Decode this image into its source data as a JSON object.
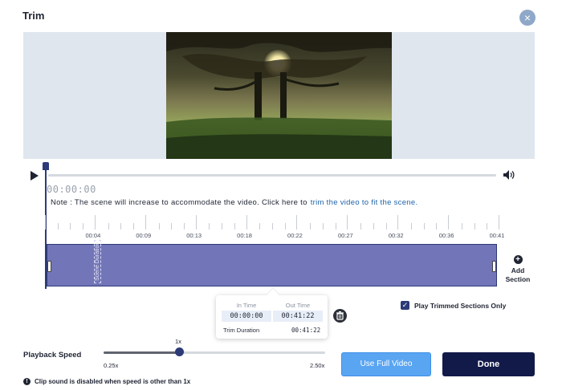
{
  "dialog": {
    "title": "Trim",
    "close_icon": "×"
  },
  "player": {
    "current_time": "00:00:00",
    "play_icon": "play-icon",
    "volume_icon": "speaker-icon"
  },
  "note": {
    "text": "Note : The scene will increase to accommodate the video. Click here to",
    "link": "trim the video to fit the scene."
  },
  "timeline": {
    "ticks": [
      "00:04",
      "00:09",
      "00:13",
      "00:18",
      "00:22",
      "00:27",
      "00:32",
      "00:36",
      "00:41"
    ],
    "section_label": "Scene Duration"
  },
  "add_section": {
    "label_line1": "Add",
    "label_line2": "Section"
  },
  "trim_popup": {
    "in_label": "In Time",
    "out_label": "Out Time",
    "in_value": "00:00:00",
    "out_value": "00:41:22",
    "duration_label": "Trim Duration",
    "duration_value": "00:41:22"
  },
  "play_trimmed": {
    "label": "Play Trimmed Sections Only",
    "checked": true
  },
  "speed": {
    "label": "Playback Speed",
    "current": "1x",
    "min": "0.25x",
    "max": "2.50x",
    "value": 1
  },
  "warning": {
    "text": "Clip sound is disabled when speed is other than 1x"
  },
  "buttons": {
    "use_full": "Use Full Video",
    "done": "Done"
  },
  "colors": {
    "accent": "#2d3a78",
    "trim": "#7275b8",
    "primary": "#5aa5f2",
    "done": "#121a4a"
  }
}
